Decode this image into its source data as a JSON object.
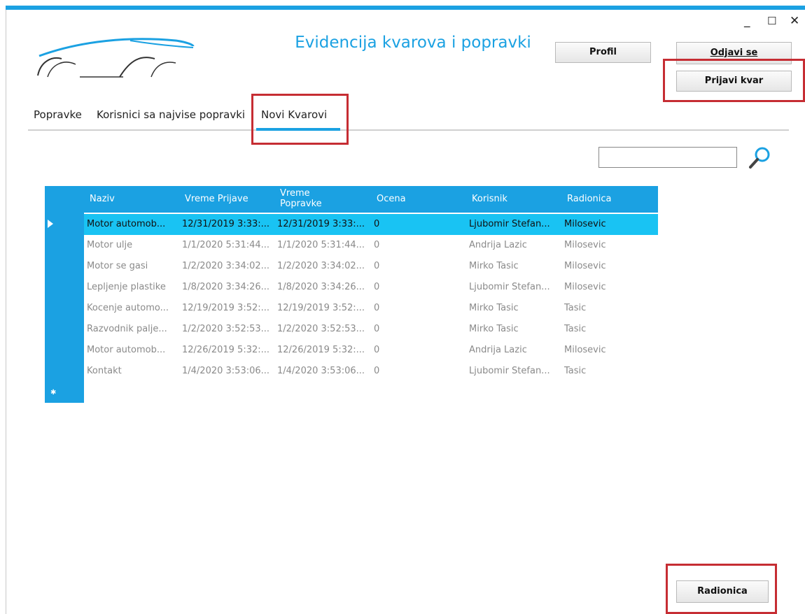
{
  "window": {
    "title": "Evidencija kvarova i popravki",
    "controls": {
      "minimize": "_",
      "maximize": "☐",
      "close": "✕"
    }
  },
  "header": {
    "profile_label": "Profil",
    "logout_label": "Odjavi se",
    "report_fault_label": "Prijavi kvar"
  },
  "tabs": [
    {
      "label": "Popravke",
      "selected": false
    },
    {
      "label": "Korisnici sa najvise popravki",
      "selected": false
    },
    {
      "label": "Novi Kvarovi",
      "selected": true
    }
  ],
  "search": {
    "value": "",
    "placeholder": ""
  },
  "table": {
    "columns": [
      "Naziv",
      "Vreme Prijave",
      "Vreme Popravke",
      "Ocena",
      "Korisnik",
      "Radionica"
    ],
    "rows": [
      [
        "Motor automob...",
        "12/31/2019 3:33:...",
        "12/31/2019 3:33:...",
        "0",
        "Ljubomir Stefan...",
        "Milosevic"
      ],
      [
        "Motor ulje",
        "1/1/2020 5:31:44...",
        "1/1/2020 5:31:44...",
        "0",
        "Andrija Lazic",
        "Milosevic"
      ],
      [
        "Motor se gasi",
        "1/2/2020 3:34:02...",
        "1/2/2020 3:34:02...",
        "0",
        "Mirko Tasic",
        "Milosevic"
      ],
      [
        "Lepljenje plastike",
        "1/8/2020 3:34:26...",
        "1/8/2020 3:34:26...",
        "0",
        "Ljubomir Stefan...",
        "Milosevic"
      ],
      [
        "Kocenje automo...",
        "12/19/2019 3:52:...",
        "12/19/2019 3:52:...",
        "0",
        "Mirko Tasic",
        "Tasic"
      ],
      [
        "Razvodnik palje...",
        "1/2/2020 3:52:53...",
        "1/2/2020 3:52:53...",
        "0",
        "Mirko Tasic",
        "Tasic"
      ],
      [
        "Motor automob...",
        "12/26/2019 5:32:...",
        "12/26/2019 5:32:...",
        "0",
        "Andrija Lazic",
        "Milosevic"
      ],
      [
        "Kontakt",
        "1/4/2020 3:53:06...",
        "1/4/2020 3:53:06...",
        "0",
        "Ljubomir Stefan...",
        "Tasic"
      ]
    ],
    "selected_row": 0
  },
  "footer": {
    "workshop_label": "Radionica"
  },
  "colors": {
    "accent": "#1ba1e2",
    "selected_row": "#19c3f3",
    "highlight": "#c62d33"
  }
}
